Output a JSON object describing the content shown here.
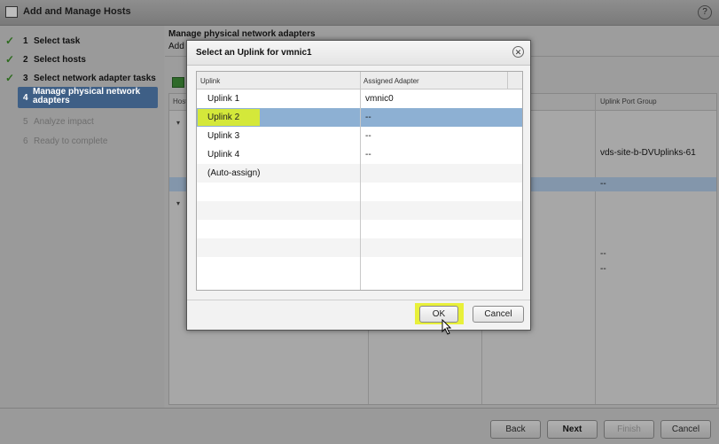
{
  "window": {
    "title": "Add and Manage Hosts",
    "help_icon": "?"
  },
  "steps": [
    {
      "check": "✓",
      "num": "1",
      "label": "Select task",
      "state": "done"
    },
    {
      "check": "✓",
      "num": "2",
      "label": "Select hosts",
      "state": "done"
    },
    {
      "check": "✓",
      "num": "3",
      "label": "Select network adapter tasks",
      "state": "done"
    },
    {
      "check": "",
      "num": "4",
      "label": "Manage physical network adapters",
      "state": "current"
    },
    {
      "check": "",
      "num": "5",
      "label": "Analyze impact",
      "state": "todo"
    },
    {
      "check": "",
      "num": "6",
      "label": "Ready to complete",
      "state": "todo"
    }
  ],
  "content": {
    "title": "Manage physical network adapters",
    "subtitle": "Add",
    "grid": {
      "col1_header": "Host",
      "col2_header": "Uplink Port Group",
      "uplink_port_group_value": "vds-site-b-DVUplinks-61",
      "selected_row_value": "--",
      "row_values": [
        "--",
        "--"
      ]
    }
  },
  "dialog": {
    "title": "Select an Uplink for vmnic1",
    "columns": [
      "Uplink",
      "Assigned Adapter"
    ],
    "rows": [
      {
        "uplink": "Uplink 1",
        "adapter": "vmnic0",
        "selected": false
      },
      {
        "uplink": "Uplink 2",
        "adapter": "--",
        "selected": true
      },
      {
        "uplink": "Uplink 3",
        "adapter": "--",
        "selected": false
      },
      {
        "uplink": "Uplink 4",
        "adapter": "--",
        "selected": false
      },
      {
        "uplink": "(Auto-assign)",
        "adapter": "",
        "selected": false
      }
    ],
    "ok_label": "OK",
    "cancel_label": "Cancel",
    "close_icon": "close-icon"
  },
  "footer": {
    "back_label": "Back",
    "next_label": "Next",
    "finish_label": "Finish",
    "cancel_label": "Cancel"
  },
  "colors": {
    "selection": "#8db0d3",
    "highlight": "#d4e83a",
    "current_step": "#3e5f86"
  }
}
